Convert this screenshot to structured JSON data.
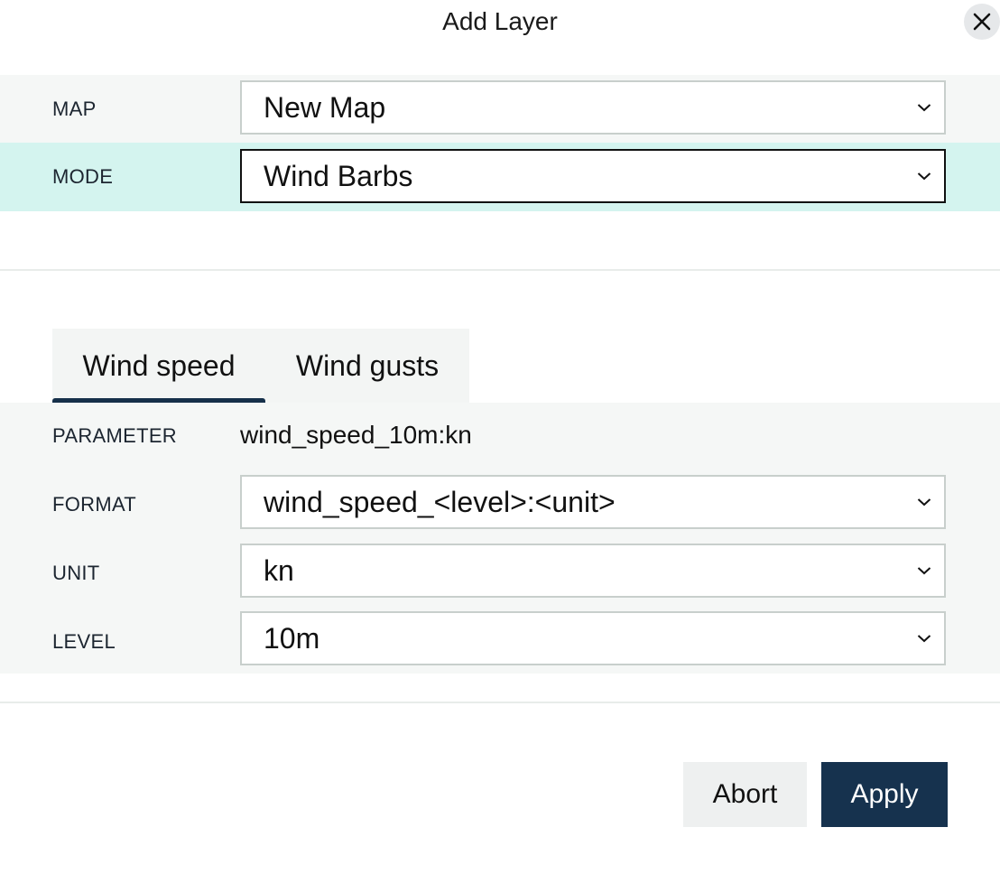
{
  "dialog": {
    "title": "Add Layer"
  },
  "map_field": {
    "label": "MAP",
    "value": "New Map"
  },
  "mode_field": {
    "label": "MODE",
    "value": "Wind Barbs"
  },
  "tabs": [
    {
      "label": "Wind speed",
      "selected": true
    },
    {
      "label": "Wind gusts",
      "selected": false
    }
  ],
  "parameter": {
    "label": "PARAMETER",
    "value": "wind_speed_10m:kn"
  },
  "format_field": {
    "label": "FORMAT",
    "value": "wind_speed_<level>:<unit>"
  },
  "unit_field": {
    "label": "UNIT",
    "value": "kn"
  },
  "level_field": {
    "label": "LEVEL",
    "value": "10m"
  },
  "buttons": {
    "abort": "Abort",
    "apply": "Apply"
  },
  "icons": {
    "close": "close-icon",
    "dropdown": "chevron-down-icon"
  },
  "colors": {
    "mode_row_highlight": "#d4f4ef",
    "tab_underline": "#16304a",
    "apply_button": "#16324e"
  }
}
